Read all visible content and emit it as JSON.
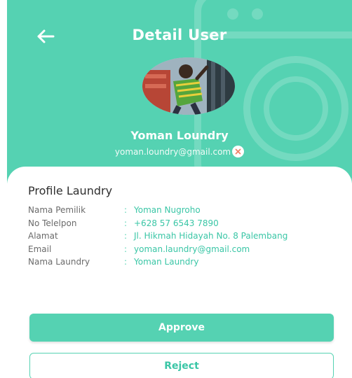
{
  "header": {
    "title": "Detail User",
    "back_icon": "arrow-left-icon"
  },
  "user": {
    "name": "Yoman Loundry",
    "email": "yoman.loundry@gmail.com",
    "email_clear_icon": "close-icon"
  },
  "profile": {
    "section_title": "Profile Laundry",
    "separator": ":",
    "rows": [
      {
        "label": "Nama Pemilik",
        "value": "Yoman Nugroho"
      },
      {
        "label": "No Telelpon",
        "value": "+628 57 6543 7890"
      },
      {
        "label": "Alamat",
        "value": "Jl. Hikmah Hidayah No. 8 Palembang"
      },
      {
        "label": "Email",
        "value": "yoman.laundry@gmail.com"
      },
      {
        "label": "Nama Laundry",
        "value": "Yoman Laundry"
      }
    ]
  },
  "actions": {
    "approve_label": "Approve",
    "reject_label": "Reject"
  },
  "colors": {
    "primary": "#55d2b2",
    "accent_text": "#3ac6a6",
    "white": "#ffffff",
    "close_icon": "#f0826a"
  }
}
